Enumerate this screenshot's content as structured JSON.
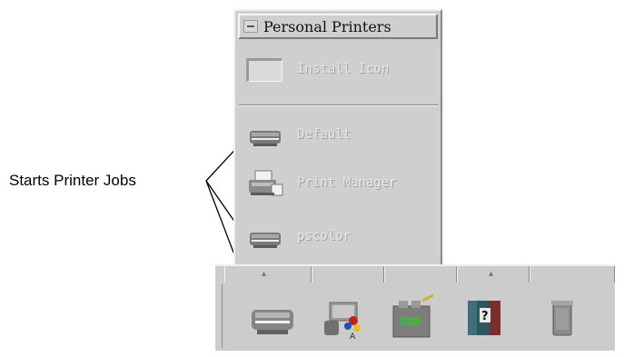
{
  "callout": {
    "label": "Starts Printer Jobs"
  },
  "subpanel": {
    "title": "Personal Printers",
    "install_label": "Install Icon",
    "items": [
      {
        "label": "Default",
        "icon": "printer-icon"
      },
      {
        "label": "Print Manager",
        "icon": "print-manager-icon"
      },
      {
        "label": "pscolor",
        "icon": "printer-icon"
      }
    ]
  },
  "front_panel": {
    "arrow_up": "▴",
    "icons": [
      "printer-icon",
      "style-manager-icon",
      "application-manager-icon",
      "help-icon",
      "trash-icon"
    ]
  }
}
